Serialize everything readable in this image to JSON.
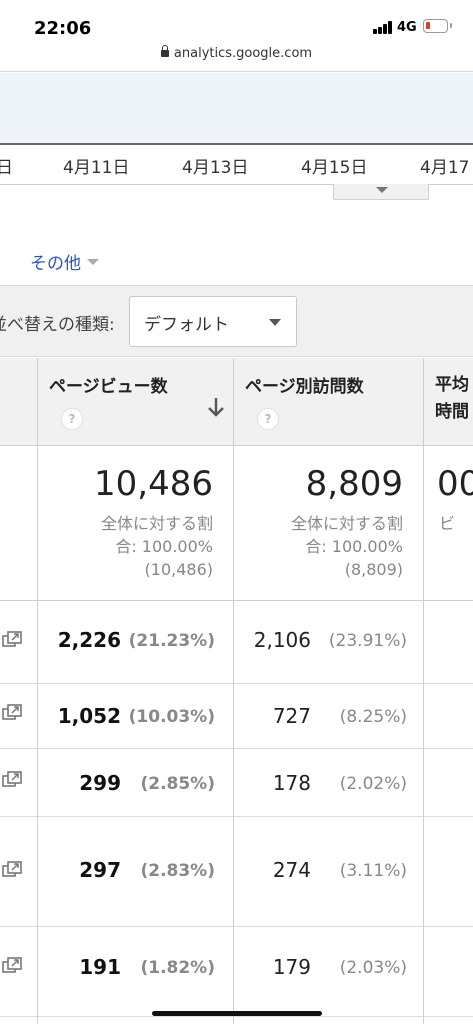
{
  "status_bar": {
    "time": "22:06",
    "network": "4G",
    "url": "analytics.google.com"
  },
  "date_axis": [
    "日",
    "4月11日",
    "4月13日",
    "4月15日",
    "4月17"
  ],
  "other_link": "その他",
  "sort": {
    "label": "並べ替えの種類:",
    "selected": "デフォルト"
  },
  "columns": [
    {
      "label": "ページビュー数",
      "help": "?"
    },
    {
      "label": "ページ別訪問数",
      "help": "?"
    },
    {
      "label_line1": "平均",
      "label_line2": "時間"
    }
  ],
  "totals": [
    {
      "value": "10,486",
      "sub1": "全体に対する割",
      "sub2": "合: 100.00%",
      "sub3": "(10,486)"
    },
    {
      "value": "8,809",
      "sub1": "全体に対する割",
      "sub2": "合: 100.00%",
      "sub3": "(8,809)"
    },
    {
      "value": "00",
      "sub1": "ビ"
    }
  ],
  "rows": [
    {
      "pageviews": "2,226",
      "pv_pct": "(21.23%)",
      "unique": "2,106",
      "u_pct": "(23.91%)"
    },
    {
      "pageviews": "1,052",
      "pv_pct": "(10.03%)",
      "unique": "727",
      "u_pct": "(8.25%)"
    },
    {
      "pageviews": "299",
      "pv_pct": "(2.85%)",
      "unique": "178",
      "u_pct": "(2.02%)"
    },
    {
      "pageviews": "297",
      "pv_pct": "(2.83%)",
      "unique": "274",
      "u_pct": "(3.11%)"
    },
    {
      "pageviews": "191",
      "pv_pct": "(1.82%)",
      "unique": "179",
      "u_pct": "(2.03%)"
    }
  ],
  "colors": {
    "link": "#2a56c6",
    "header_bg": "#f1f1f1",
    "band_bg": "#eef4fa",
    "battery_low": "#e23b2e"
  }
}
